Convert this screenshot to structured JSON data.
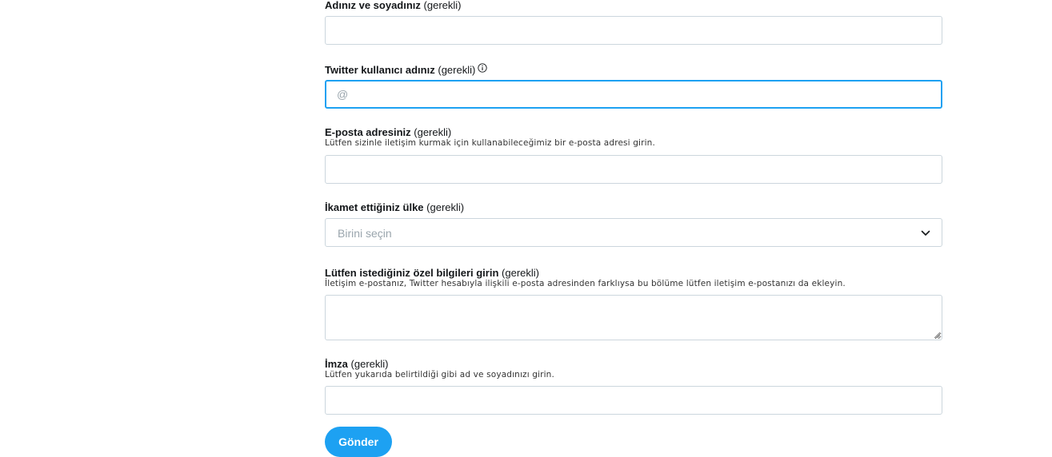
{
  "form": {
    "name_field": {
      "label": "Adınız ve soyadınız",
      "required": "(gerekli)",
      "value": ""
    },
    "twitter_field": {
      "label": "Twitter kullanıcı adınız",
      "required": "(gerekli)",
      "icon": "info-icon",
      "placeholder": "@",
      "value": ""
    },
    "email_field": {
      "label": "E-posta adresiniz",
      "required": "(gerekli)",
      "hint": "Lütfen sizinle iletişim kurmak için kullanabileceğimiz bir e-posta adresi girin.",
      "value": ""
    },
    "country_field": {
      "label": "İkamet ettiğiniz ülke",
      "required": "(gerekli)",
      "selected": "Birini seçin",
      "icon": "chevron-down-icon"
    },
    "details_field": {
      "label": "Lütfen istediğiniz özel bilgileri girin",
      "required": "(gerekli)",
      "hint": "İletişim e-postanız, Twitter hesabıyla ilişkili e-posta adresinden farklıysa bu bölüme lütfen iletişim e-postanızı da ekleyin.",
      "value": ""
    },
    "signature_field": {
      "label": "İmza",
      "required": "(gerekli)",
      "hint": "Lütfen yukarıda belirtildiği gibi ad ve soyadınızı girin.",
      "value": ""
    },
    "submit_label": "Gönder"
  },
  "colors": {
    "accent": "#1da1f2",
    "border": "#ccd6dd",
    "placeholder": "#9aa5ad",
    "text": "#14171a"
  }
}
